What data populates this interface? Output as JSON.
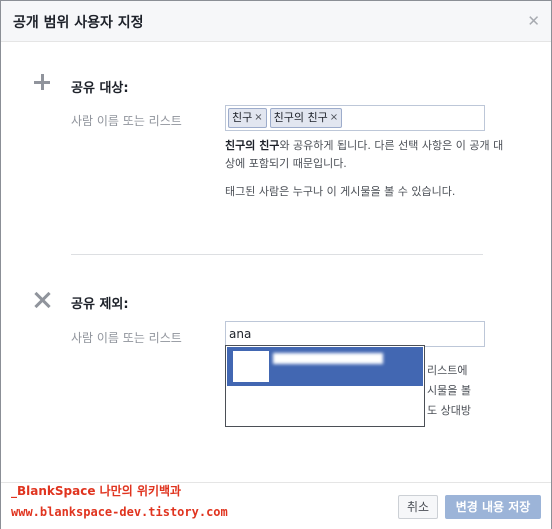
{
  "dialog": {
    "title": "공개 범위 사용자 지정",
    "close_icon": "close-icon"
  },
  "share_with": {
    "icon": "plus-icon",
    "title": "공유 대상:",
    "field_label": "사람 이름 또는 리스트",
    "tokens": [
      "친구",
      "친구의 친구"
    ],
    "remove_glyph": "×",
    "info_bold": "친구의 친구",
    "info_rest": "와 공유하게 됩니다. 다른 선택 사항은 이 공개 대상에 포함되기 때문입니다.",
    "info_tagged": "태그된 사람은 누구나 이 게시물을 볼 수 있습니다."
  },
  "exclude": {
    "icon": "x-icon",
    "title": "공유 제외:",
    "field_label": "사람 이름 또는 리스트",
    "input_value": "ana",
    "hidden_lines": [
      "리스트에",
      "시물을 볼",
      "도 상대방"
    ]
  },
  "footer": {
    "cancel_label": "취소",
    "save_label": "변경 내용 저장"
  },
  "watermark": {
    "line1": "_BlankSpace 나만의 위키백과",
    "line2": "www.blankspace-dev.tistory.com"
  }
}
